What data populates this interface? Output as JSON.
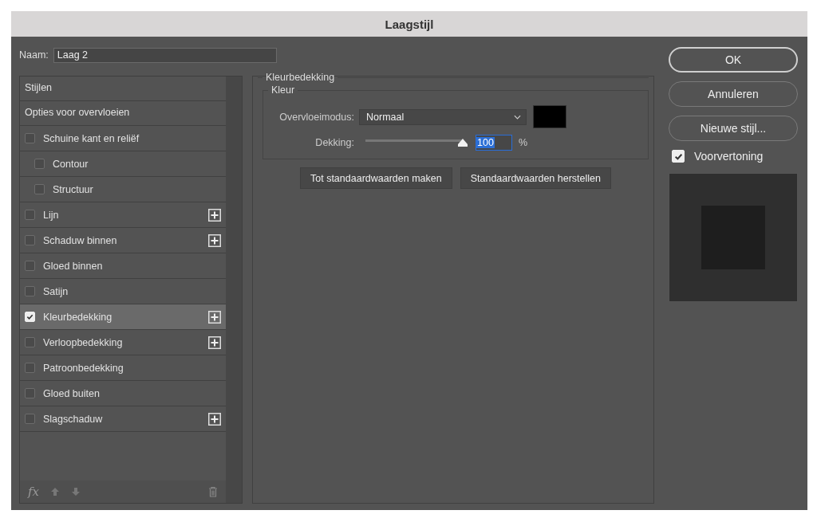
{
  "window": {
    "title": "Laagstijl"
  },
  "name_field": {
    "label": "Naam:",
    "value": "Laag 2"
  },
  "styles": [
    {
      "label": "Stijlen",
      "kind": "header"
    },
    {
      "label": "Opties voor overvloeien",
      "kind": "header"
    },
    {
      "label": "Schuine kant en reliëf",
      "kind": "effect",
      "checked": false,
      "selected": false,
      "add_button": false,
      "children": [
        {
          "label": "Contour",
          "checked": false,
          "selected": false,
          "add_button": false
        },
        {
          "label": "Structuur",
          "checked": false,
          "selected": false,
          "add_button": false
        }
      ]
    },
    {
      "label": "Lijn",
      "kind": "effect",
      "checked": false,
      "selected": false,
      "add_button": true
    },
    {
      "label": "Schaduw binnen",
      "kind": "effect",
      "checked": false,
      "selected": false,
      "add_button": true
    },
    {
      "label": "Gloed binnen",
      "kind": "effect",
      "checked": false,
      "selected": false,
      "add_button": false
    },
    {
      "label": "Satijn",
      "kind": "effect",
      "checked": false,
      "selected": false,
      "add_button": false
    },
    {
      "label": "Kleurbedekking",
      "kind": "effect",
      "checked": true,
      "selected": true,
      "add_button": true
    },
    {
      "label": "Verloopbedekking",
      "kind": "effect",
      "checked": false,
      "selected": false,
      "add_button": true
    },
    {
      "label": "Patroonbedekking",
      "kind": "effect",
      "checked": false,
      "selected": false,
      "add_button": false
    },
    {
      "label": "Gloed buiten",
      "kind": "effect",
      "checked": false,
      "selected": false,
      "add_button": false
    },
    {
      "label": "Slagschaduw",
      "kind": "effect",
      "checked": false,
      "selected": false,
      "add_button": true
    }
  ],
  "footer": {
    "fx": "fx"
  },
  "panel": {
    "title": "Kleurbedekking",
    "group": "Kleur",
    "blend": {
      "label": "Overvloeimodus:",
      "value": "Normaal",
      "color": "#000000"
    },
    "opacity": {
      "label": "Dekking:",
      "level": 1,
      "value": "100",
      "unit": "%"
    },
    "buttons": [
      "Tot standaardwaarden maken",
      "Standaardwaarden herstellen"
    ]
  },
  "actions": [
    {
      "label": "OK",
      "default": true
    },
    {
      "label": "Annuleren",
      "default": false
    },
    {
      "label": "Nieuwe stijl...",
      "default": false
    }
  ],
  "preview": {
    "label": "Voorvertoning",
    "checked": true
  }
}
